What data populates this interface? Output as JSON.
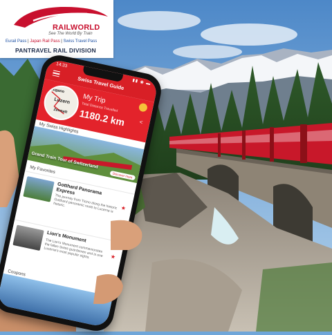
{
  "logo": {
    "brand": "RAILWORLD",
    "tagline": "See The World By Train",
    "passes": {
      "eurail": "Eurail Pass",
      "japan": "Japan Rail Pass",
      "swiss": "Swiss Travel Pass",
      "separator": " | "
    },
    "division": "PANTRAVEL RAIL DIVISION",
    "brand_color": "#c8102e",
    "division_color": "#1c2b4a"
  },
  "phone": {
    "status_time": "14:33",
    "status_icons": "▮▮ ◉ ▬",
    "app_title": "Swiss Travel Guide",
    "menu_icon": "menu-icon",
    "header_color": "#d81f26",
    "trip": {
      "title": "My Trip",
      "subtitle": "Total Distance Travelled",
      "value": "1180.2 km",
      "map_place_1": "Luzern",
      "map_place_2": "Zermatt",
      "map_place_3": "Lugano"
    },
    "highlights": {
      "section_title": "My Swiss Highlights",
      "caption": "Grand Train Tour of Switzerland",
      "button": "Discover more"
    },
    "favorites": {
      "section_title": "My Favorites",
      "items": [
        {
          "name": "Gotthard Panorama Express",
          "desc": "The journey from Ticino along the historic Gotthard panoramic route to Lucerne is historic."
        },
        {
          "name": "Lion's Monument",
          "desc": "The Lion's Monument commemorates the fallen Swiss guardsmen and is one Lucerne's most popular sights."
        }
      ]
    },
    "coupons": {
      "section_title": "Coupons"
    }
  }
}
